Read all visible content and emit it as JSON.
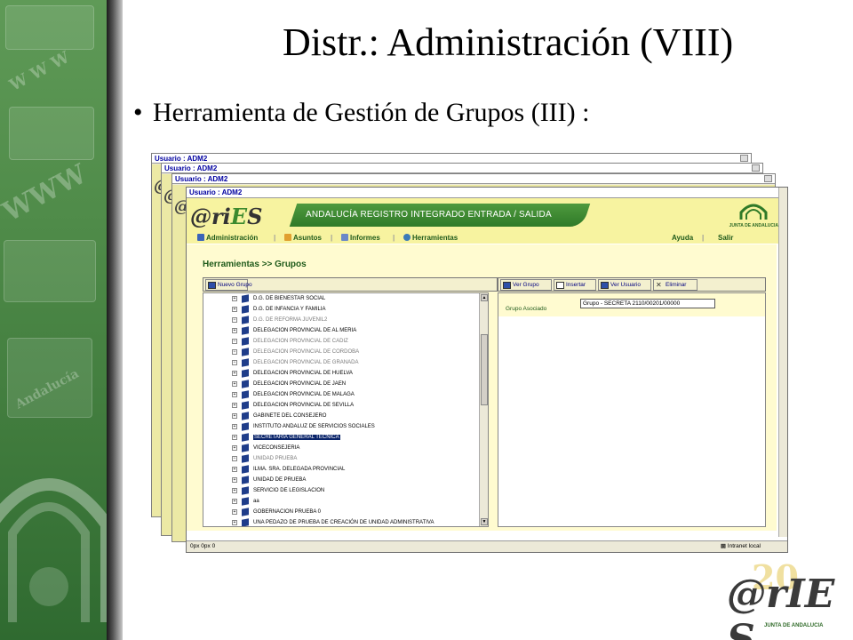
{
  "slide": {
    "title": "Distr.: Administración (VIII)",
    "bullet": "Herramienta de Gestión de Grupos (III) :"
  },
  "windows": {
    "caption": "Usuario : ADM2"
  },
  "app": {
    "logo": "@rIE S",
    "banner_text": "ANDALUCÍA REGISTRO INTEGRADO ENTRADA / SALIDA",
    "junta_label": "JUNTA DE ANDALUCIA",
    "menu": {
      "administracion": "Administración",
      "asuntos": "Asuntos",
      "informes": "Informes",
      "herramientas": "Herramientas",
      "ayuda": "Ayuda",
      "salir": "Salir"
    },
    "breadcrumb": "Herramientas >> Grupos",
    "toolbar_left": {
      "nuevo_grupo": "Nuevo Grupo"
    },
    "toolbar_right": {
      "ver_grupo": "Ver Grupo",
      "insertar": "Insertar",
      "ver_usuario": "Ver Usuario",
      "eliminar": "Eliminar"
    },
    "tree": [
      {
        "label": "D.G. DE BIENESTAR SOCIAL",
        "muted": false
      },
      {
        "label": "D.G. DE INFANCIA Y FAMILIA",
        "muted": false
      },
      {
        "label": "D.G. DE REFORMA JUVENIL2",
        "muted": true
      },
      {
        "label": "DELEGACION PROVINCIAL DE AL MERIA",
        "muted": false
      },
      {
        "label": "DELEGACION PROVINCIAL DE CADIZ",
        "muted": true
      },
      {
        "label": "DELEGACION PROVINCIAL DE CORDOBA",
        "muted": true
      },
      {
        "label": "DELEGACION PROVINCIAL DE GRANADA",
        "muted": true
      },
      {
        "label": "DELEGACION PROVINCIAL DE HUELVA",
        "muted": false
      },
      {
        "label": "DELEGACION PROVINCIAL DE JAEN",
        "muted": false
      },
      {
        "label": "DELEGACION PROVINCIAL DE MALAGA",
        "muted": false
      },
      {
        "label": "DELEGACION PROVINCIAL DE SEVILLA",
        "muted": false
      },
      {
        "label": "GABINETE DEL CONSEJERO",
        "muted": false
      },
      {
        "label": "INSTITUTO ANDALUZ DE SERVICIOS SOCIALES",
        "muted": false
      },
      {
        "label": "SECRETARIA GENERAL TECNICA",
        "muted": false,
        "selected": true
      },
      {
        "label": "VICECONSEJERIA",
        "muted": false
      },
      {
        "label": "UNIDAD PRUEBA",
        "muted": true
      },
      {
        "label": "ILMA. SRA. DELEGADA PROVINCIAL",
        "muted": false
      },
      {
        "label": "UNIDAD DE PRUEBA",
        "muted": false
      },
      {
        "label": "SERVICIO DE LEGISLACION",
        "muted": false
      },
      {
        "label": "aa",
        "muted": false
      },
      {
        "label": "GOBERNACION PRUEBA 0",
        "muted": false
      },
      {
        "label": "UNA PEDAZO DE PRUEBA DE CREACIÓN DE UNIDAD ADMINISTRATIVA",
        "muted": false
      }
    ],
    "grupo_asociado_label": "Grupo Asociado",
    "grupo_asociado_value": "Grupo - SECRETA 2110/00201/00000",
    "status_text": "0px 0px 0",
    "status_zone": "Intranet local"
  },
  "footer_logo": {
    "text": "@rIE S",
    "subtitle": "JUNTA DE ANDALUCIA"
  },
  "colors": {
    "banner_yellow": "#f7f3a0",
    "green": "#2f7a28",
    "selection": "#0a246a"
  }
}
